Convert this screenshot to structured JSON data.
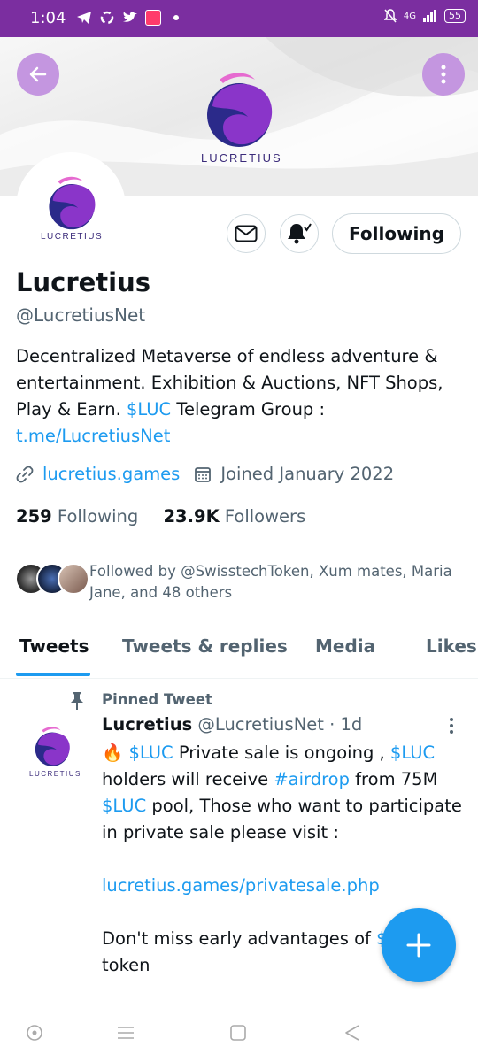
{
  "status_bar": {
    "time": "1:04",
    "left_icons": [
      "telegram-icon",
      "recycle-icon",
      "twitter-icon",
      "app-icon",
      "dot-icon"
    ],
    "network": "4G",
    "battery": "55"
  },
  "header": {
    "brand": "LUCRETIUS",
    "back_icon": "arrow-left-icon",
    "more_icon": "more-vertical-icon",
    "accent_color": "#c496e0"
  },
  "profile": {
    "avatar_brand": "LUCRETIUS",
    "name": "Lucretius",
    "handle": "@LucretiusNet",
    "bio": {
      "part1": "Decentralized Metaverse of endless adventure & entertainment. Exhibition & Auctions, NFT Shops, Play & Earn. ",
      "cashtag": "$LUC",
      "part2": "  Telegram Group : ",
      "link": "t.me/LucretiusNet"
    },
    "website": "lucretius.games",
    "joined": "Joined January 2022",
    "following_count": "259",
    "following_label": "Following",
    "followers_count": "23.9K",
    "followers_label": "Followers",
    "followed_by": "Followed by @SwisstechToken, Xum mates, Maria Jane, and 48 others",
    "follow_button_label": "Following"
  },
  "tabs": [
    {
      "label": "Tweets",
      "active": true
    },
    {
      "label": "Tweets & replies",
      "active": false
    },
    {
      "label": "Media",
      "active": false
    },
    {
      "label": "Likes",
      "active": false
    }
  ],
  "pinned_tweet": {
    "pinned_label": "Pinned Tweet",
    "author_name": "Lucretius",
    "author_handle": "@LucretiusNet",
    "time": "· 1d",
    "avatar_brand": "LUCRETIUS",
    "emoji": "🔥",
    "cashtag": "$LUC",
    "text_1": " Private sale is ongoing , ",
    "text_2": " holders will receive ",
    "hashtag": "#airdrop",
    "text_3": " from 75M ",
    "text_4": " pool, Those who want to participate in private sale please visit :",
    "link": "lucretius.games/privatesale.php",
    "text_5": "Don't miss early advantages of ",
    "text_6": "token"
  },
  "colors": {
    "link_blue": "#1d9bf0",
    "status_bar_purple": "#7b2ea0",
    "brand_purple": "#8a35c9",
    "brand_navy": "#2b2a8a"
  }
}
